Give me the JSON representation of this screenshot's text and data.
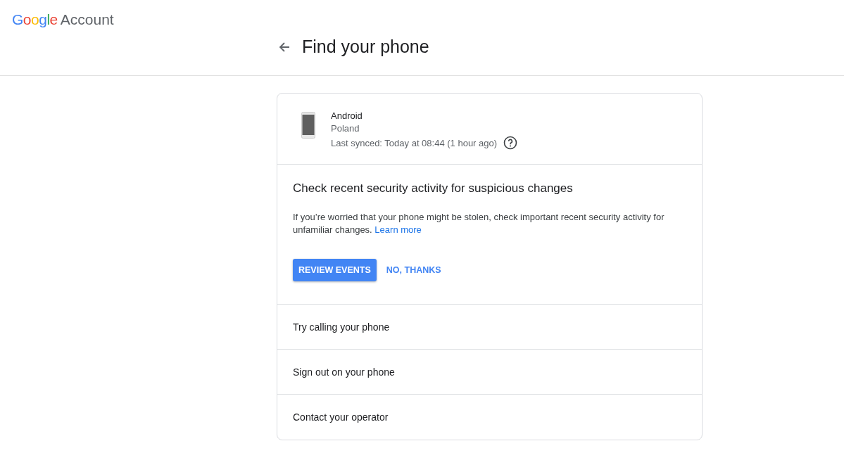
{
  "header": {
    "logo_word": "Google",
    "product": "Account",
    "title": "Find your phone"
  },
  "device": {
    "name": "Android",
    "location": "Poland",
    "last_synced": "Last synced: Today at 08:44 (1 hour ago)"
  },
  "security": {
    "heading": "Check recent security activity for suspicious changes",
    "text": "If you’re worried that your phone might be stolen, check important recent security activity for unfamiliar changes.",
    "link": "Learn more",
    "primary_button": "REVIEW EVENTS",
    "secondary_button": "NO, THANKS"
  },
  "actions": [
    {
      "label": "Try calling your phone"
    },
    {
      "label": "Sign out on your phone"
    },
    {
      "label": "Contact your operator"
    }
  ]
}
